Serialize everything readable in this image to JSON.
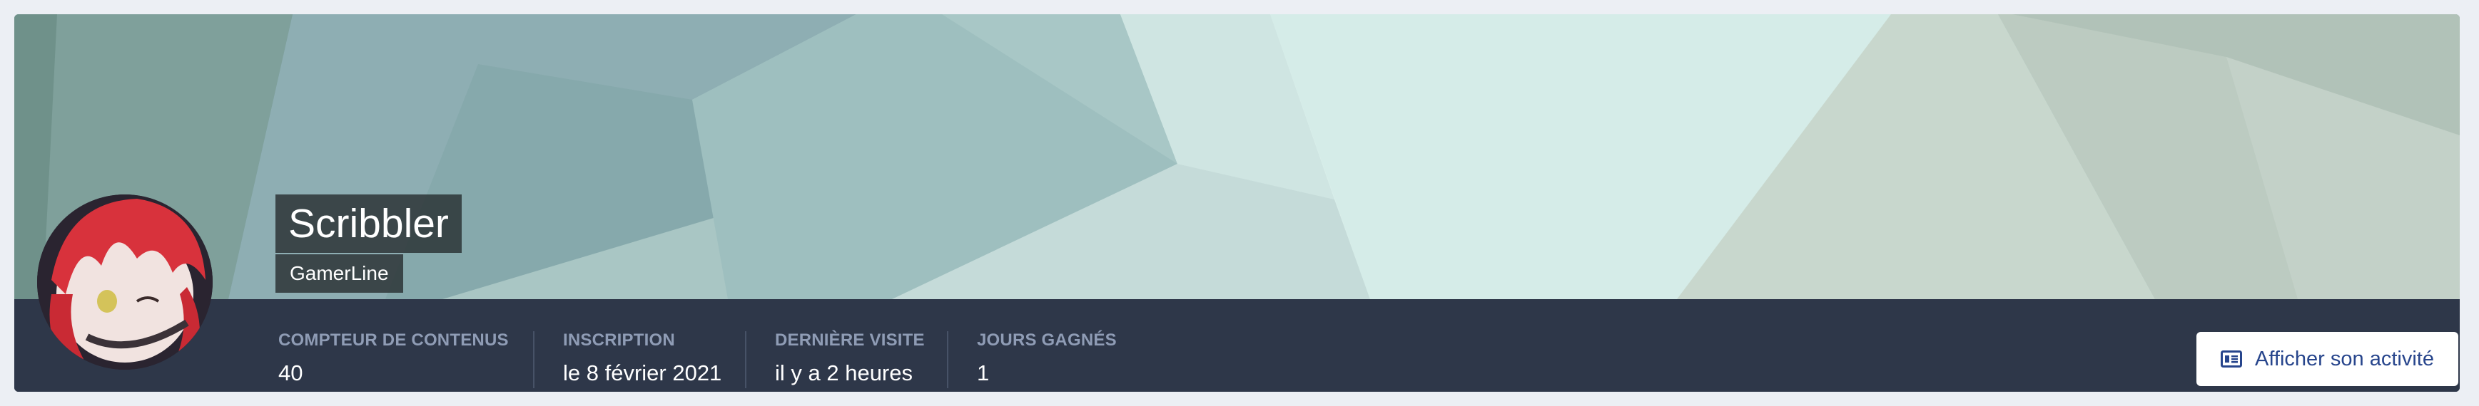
{
  "profile": {
    "name": "Scribbler",
    "group": "GamerLine"
  },
  "stats": [
    {
      "label": "COMPTEUR DE CONTENUS",
      "value": "40"
    },
    {
      "label": "INSCRIPTION",
      "value": "le 8 février 2021"
    },
    {
      "label": "DERNIÈRE VISITE",
      "value": "il y a 2 heures"
    },
    {
      "label": "JOURS GAGNÉS",
      "value": "1"
    }
  ],
  "actions": {
    "activity_label": "Afficher son activité",
    "activity_icon": "activity-list-icon"
  },
  "colors": {
    "info_bar": "#2e3749",
    "label_text": "#8f9cb5",
    "button_text": "#27458c"
  }
}
